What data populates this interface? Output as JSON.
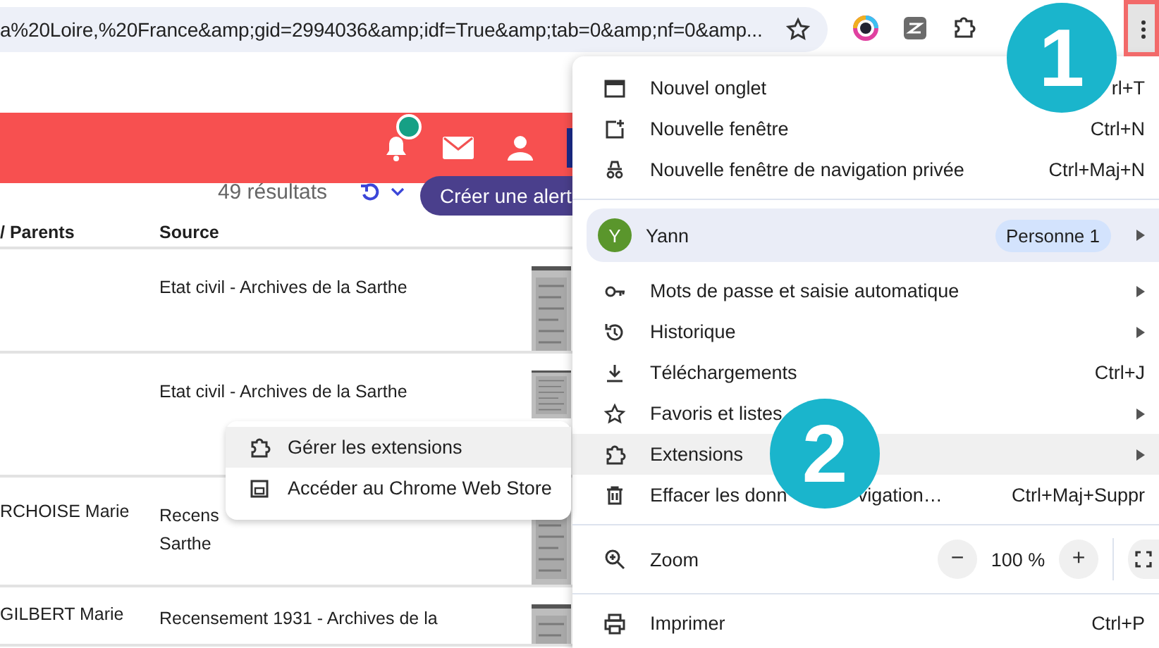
{
  "browser": {
    "address": "a%20Loire,%20France&amp;gid=2994036&amp;idf=True&amp;tab=0&amp;nf=0&amp..."
  },
  "site": {
    "has_notification": true,
    "results": "49 résultats",
    "alert_button": "Créer une alert"
  },
  "table": {
    "columns": [
      "/ Parents",
      "Source"
    ],
    "rows": [
      {
        "source": [
          "Etat civil - Archives de la Sarthe"
        ]
      },
      {
        "source": [
          "Etat civil - Archives de la Sarthe"
        ]
      },
      {
        "name": "RCHOISE Marie",
        "source": [
          "Recens",
          "Sarthe"
        ]
      },
      {
        "name": "GILBERT Marie",
        "source": [
          "Recensement 1931 - Archives de la"
        ]
      }
    ]
  },
  "menu": {
    "items": [
      {
        "kind": "item",
        "label": "Nouvel onglet",
        "shortcut": "rl+T",
        "selected": false
      },
      {
        "kind": "item",
        "label": "Nouvelle fenêtre",
        "shortcut": "Ctrl+N",
        "selected": false
      },
      {
        "kind": "item",
        "label": "Nouvelle fenêtre de navigation privée",
        "shortcut": "Ctrl+Maj+N",
        "selected": false
      },
      {
        "kind": "separator"
      },
      {
        "kind": "profile",
        "initial": "Y",
        "label": "Yann",
        "badge": "Personne 1",
        "submenu": true,
        "selected": false
      },
      {
        "kind": "item",
        "label": "Mots de passe et saisie automatique",
        "submenu": true,
        "selected": false
      },
      {
        "kind": "item",
        "label": "Historique",
        "submenu": true,
        "selected": false
      },
      {
        "kind": "item",
        "label": "Téléchargements",
        "shortcut": "Ctrl+J",
        "selected": false
      },
      {
        "kind": "item",
        "label": "Favoris et listes",
        "submenu": true,
        "selected": false
      },
      {
        "kind": "item",
        "label": "Extensions",
        "submenu": true,
        "selected": true
      },
      {
        "kind": "item",
        "label": "Effacer les donn",
        "label_continued": "vigation…",
        "shortcut": "Ctrl+Maj+Suppr",
        "selected": false
      },
      {
        "kind": "separator"
      },
      {
        "kind": "zoom",
        "label": "Zoom",
        "minus": "−",
        "value": "100 %",
        "plus": "+"
      },
      {
        "kind": "separator"
      },
      {
        "kind": "item",
        "label": "Imprimer",
        "shortcut": "Ctrl+P",
        "selected": false
      }
    ]
  },
  "submenu": {
    "items": [
      {
        "label": "Gérer les extensions",
        "selected": true
      },
      {
        "label": "Accéder au Chrome Web Store",
        "selected": false
      }
    ]
  },
  "annotations": [
    {
      "label": "1"
    },
    {
      "label": "2"
    }
  ]
}
